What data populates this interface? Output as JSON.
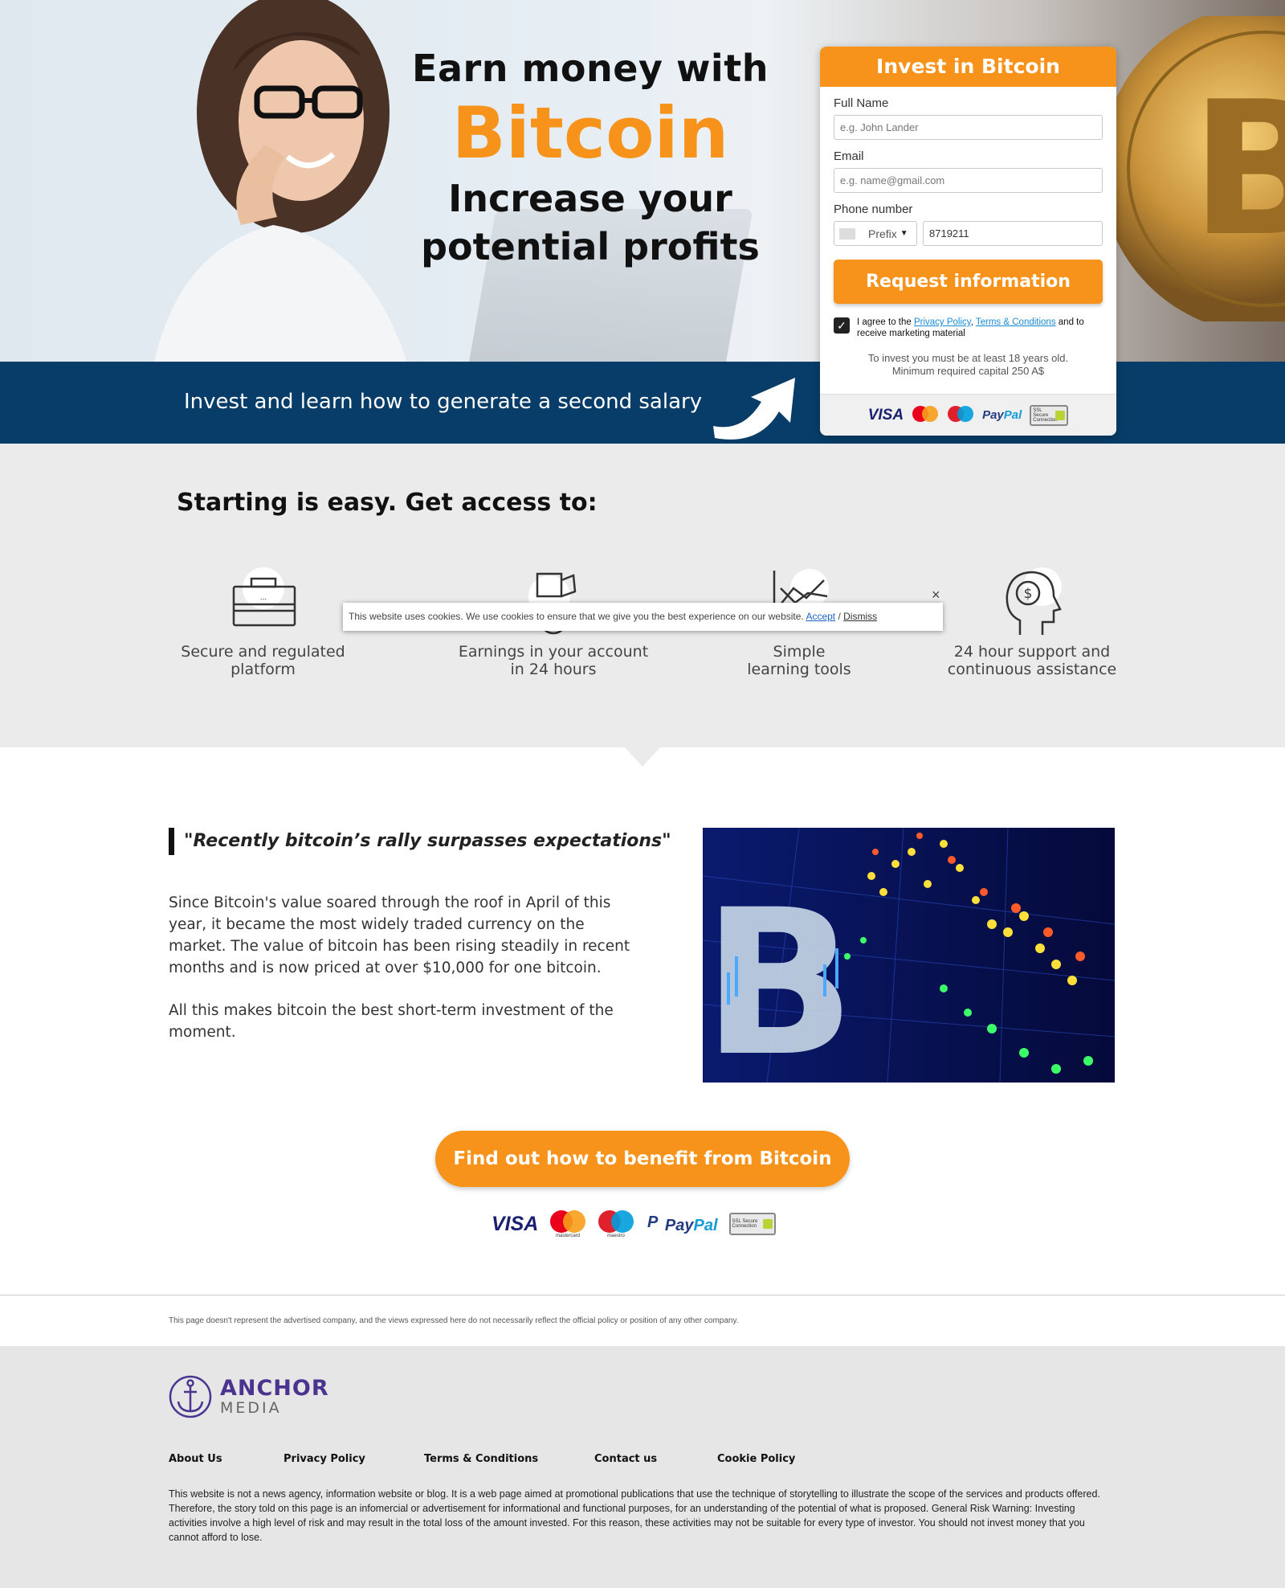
{
  "hero": {
    "line1": "Earn money with",
    "line2": "Bitcoin",
    "line3": "Increase your",
    "line4": "potential profits"
  },
  "band": {
    "slogan": "Invest and learn how to generate a second salary"
  },
  "form": {
    "title": "Invest in Bitcoin",
    "full_name_label": "Full Name",
    "full_name_placeholder": "e.g. John Lander",
    "email_label": "Email",
    "email_placeholder": "e.g. name@gmail.com",
    "phone_label": "Phone number",
    "prefix_label": "Prefix",
    "phone_value": "8719211",
    "submit_label": "Request information",
    "agree_prefix": "I agree to the ",
    "privacy_link": "Privacy Policy",
    "comma": ", ",
    "terms_link": "Terms & Conditions",
    "agree_suffix": " and to receive marketing material",
    "notice_line1": "To invest you must be at least 18 years old.",
    "notice_line2": "Minimum required capital 250 A$"
  },
  "payments": {
    "visa": "VISA",
    "mastercard": "mastercard",
    "maestro": "maestro",
    "paypal_a": "Pay",
    "paypal_b": "Pal",
    "ssl": "SSL Secure Connection"
  },
  "features": {
    "heading": "Starting is easy. Get access to:",
    "items": [
      {
        "line1": "Secure and regulated",
        "line2": "platform",
        "icon": "briefcase-icon"
      },
      {
        "line1": "Earnings in your account",
        "line2": "in 24 hours",
        "icon": "money-hand-icon"
      },
      {
        "line1": "Simple",
        "line2": "learning tools",
        "icon": "chart-icon"
      },
      {
        "line1": "24 hour support and",
        "line2": "continuous assistance",
        "icon": "head-dollar-icon"
      }
    ]
  },
  "cookie": {
    "text": "This website uses cookies. We use cookies to ensure that we give you the best experience on our website. ",
    "accept": "Accept",
    "sep": " / ",
    "dismiss": "Dismiss",
    "close": "×"
  },
  "article": {
    "quote": "\"Recently bitcoin’s rally surpasses expectations\"",
    "para1": "Since Bitcoin's value soared through the roof in April of this year, it became the most widely traded currency on the market. The value of bitcoin has been rising steadily in recent months and is now priced at over $10,000 for one bitcoin.",
    "para2": "All this makes bitcoin the best short-term investment of the moment.",
    "cta": "Find out how to benefit from Bitcoin"
  },
  "disclaimer": "This page doesn't represent the advertised company, and the views expressed here do not necessarily reflect the official policy or position of any other company.",
  "footer": {
    "logo_top": "ANCHOR",
    "logo_bottom": "MEDIA",
    "links": [
      "About Us",
      "Privacy Policy",
      "Terms & Conditions",
      "Contact us",
      "Cookie Policy"
    ],
    "legal": "This website is not a news agency, information website or blog. It is a web page aimed at promotional publications that use the technique of storytelling to illustrate the scope of the services and products offered. Therefore, the story told on this page is an infomercial or advertisement for informational and functional purposes, for an understanding of the potential of what is proposed. General Risk Warning: Investing activities involve a high level of risk and may result in the total loss of the amount invested. For this reason, these activities may not be suitable for every type of investor. You should not invest money that you cannot afford to lose."
  },
  "colors": {
    "accent": "#f7931a",
    "band": "#073d68",
    "link": "#1a8ad6",
    "brand": "#4a3490"
  }
}
